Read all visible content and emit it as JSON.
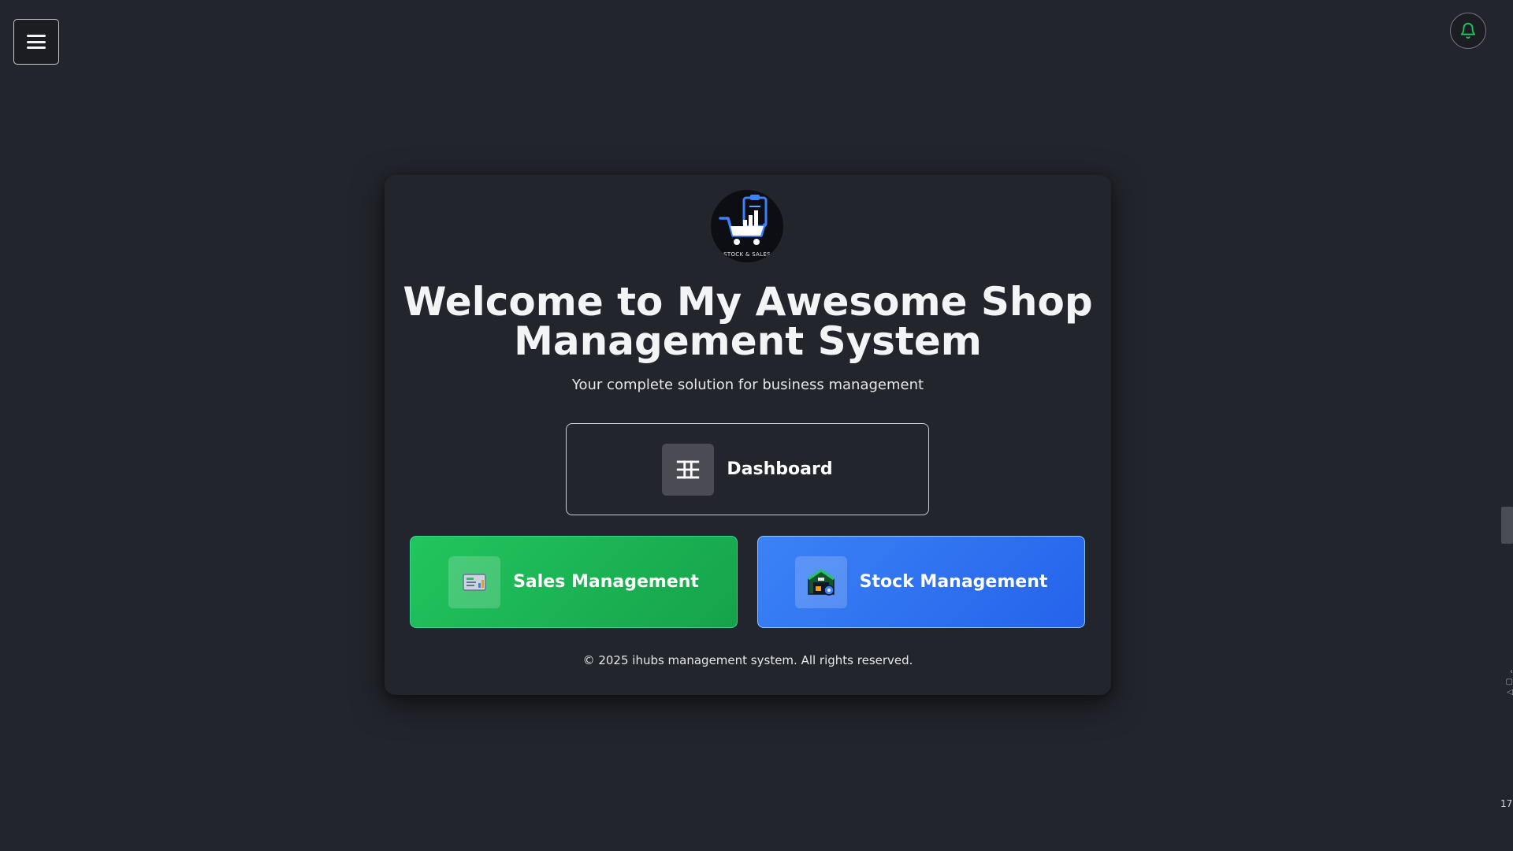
{
  "header": {
    "menu_icon": "hamburger-menu-icon",
    "notification_icon": "bell-icon",
    "accent_color": "#22c55e"
  },
  "logo": {
    "icon": "shopping-cart-chart-logo",
    "text": "STOCK & SALES"
  },
  "hero": {
    "title": "Welcome to My Awesome Shop Management System",
    "subtitle": "Your complete solution for business management"
  },
  "actions": {
    "dashboard": {
      "label": "Dashboard",
      "icon": "table-grid-icon",
      "color": "#23252d"
    },
    "sales": {
      "label": "Sales Management",
      "icon": "sales-report-icon",
      "color": "#22c55e"
    },
    "stock": {
      "label": "Stock Management",
      "icon": "warehouse-icon",
      "color": "#3b82f6"
    }
  },
  "footer": {
    "copyright": "© 2025 ihubs management system. All rights reserved."
  },
  "edge": {
    "number": "17"
  }
}
